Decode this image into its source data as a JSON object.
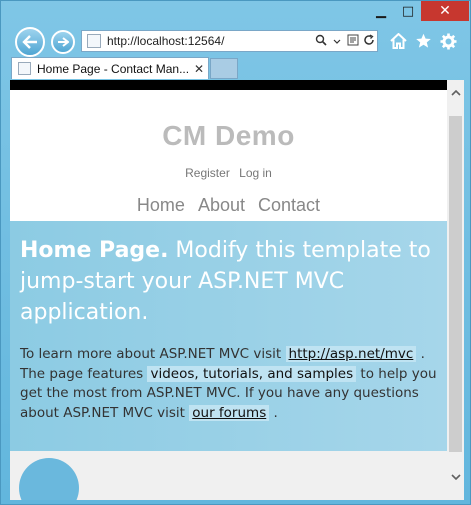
{
  "browser": {
    "url": "http://localhost:12564/",
    "tabs": [
      {
        "title": "Home Page - Contact Man..."
      }
    ],
    "window_controls": {
      "minimize": "▁",
      "maximize": "□",
      "close": "✕"
    }
  },
  "site": {
    "title": "CM Demo",
    "login_links": [
      "Register",
      "Log in"
    ],
    "menu": [
      "Home",
      "About",
      "Contact"
    ]
  },
  "featured": {
    "heading_bold": "Home Page.",
    "heading_rest": " Modify this template to jump-start your ASP.NET MVC application.",
    "p_part1": "To learn more about ASP.NET MVC visit ",
    "p_link1": "http://asp.net/mvc",
    "p_part2": " . The page features ",
    "p_highlight": "videos, tutorials, and samples",
    "p_part3": " to help you get the most from ASP.NET MVC. If you have any questions about ASP.NET MVC visit ",
    "p_link2": "our forums",
    "p_part4": " ."
  },
  "icons": {
    "back": "back-arrow-icon",
    "forward": "forward-arrow-icon",
    "search": "search-icon",
    "compat": "compatibility-view-icon",
    "refresh": "refresh-icon",
    "home": "home-icon",
    "favorites": "star-icon",
    "tools": "gear-icon"
  },
  "colors": {
    "chrome": "#62b6dd",
    "close": "#c7372f",
    "featured_bg": "#9bd1e7",
    "title_gray": "#bbbbbb"
  }
}
